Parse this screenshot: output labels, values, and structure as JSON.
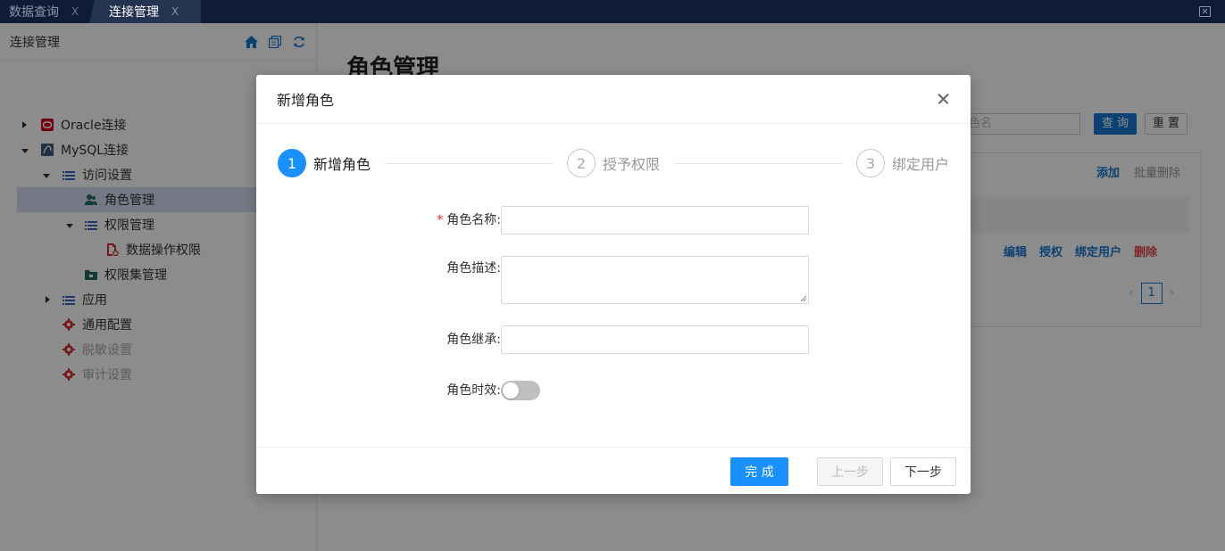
{
  "tabs": [
    {
      "label": "数据查询",
      "close": "X",
      "active": false
    },
    {
      "label": "连接管理",
      "close": "X",
      "active": true
    }
  ],
  "sidebar": {
    "title": "连接管理",
    "tools": [
      "home-icon",
      "copy-icon",
      "refresh-icon"
    ],
    "items": [
      {
        "label": "Oracle连接",
        "icon": "oracle-icon",
        "expanded": false
      },
      {
        "label": "MySQL连接",
        "icon": "mysql-icon",
        "expanded": true
      },
      {
        "label": "访问设置",
        "icon": "list-icon",
        "expanded": true
      },
      {
        "label": "角色管理",
        "icon": "user-group-icon",
        "selected": true
      },
      {
        "label": "权限管理",
        "icon": "list-icon",
        "expanded": true
      },
      {
        "label": "数据操作权限",
        "icon": "doc-gear-icon"
      },
      {
        "label": "权限集管理",
        "icon": "folder-icon"
      },
      {
        "label": "应用",
        "icon": "list-icon",
        "expanded": false
      },
      {
        "label": "通用配置",
        "icon": "gear-icon"
      },
      {
        "label": "脱敏设置",
        "icon": "gear-icon",
        "disabled": true
      },
      {
        "label": "审计设置",
        "icon": "gear-icon",
        "disabled": true
      }
    ]
  },
  "main": {
    "title": "角色管理",
    "search_placeholder": "色名",
    "query_label": "查 询",
    "reset_label": "重 置",
    "add_label": "添加",
    "batch_delete_label": "批量删除",
    "row_actions": [
      "编辑",
      "授权",
      "绑定用户",
      "删除"
    ],
    "pager": {
      "prev": "‹",
      "page": "1",
      "next": "›"
    }
  },
  "modal": {
    "title": "新增角色",
    "steps": [
      {
        "num": "1",
        "label": "新增角色",
        "active": true
      },
      {
        "num": "2",
        "label": "授予权限",
        "active": false
      },
      {
        "num": "3",
        "label": "绑定用户",
        "active": false
      }
    ],
    "form": {
      "name_label": "角色名称:",
      "name_value": "",
      "desc_label": "角色描述:",
      "desc_value": "",
      "inherit_label": "角色继承:",
      "inherit_value": "",
      "expiry_label": "角色时效:",
      "expiry_on": false
    },
    "buttons": {
      "finish": "完 成",
      "prev": "上一步",
      "next": "下一步"
    }
  },
  "colors": {
    "primary": "#1890ff",
    "tabbar": "#0f1c36",
    "danger": "#e64545"
  }
}
